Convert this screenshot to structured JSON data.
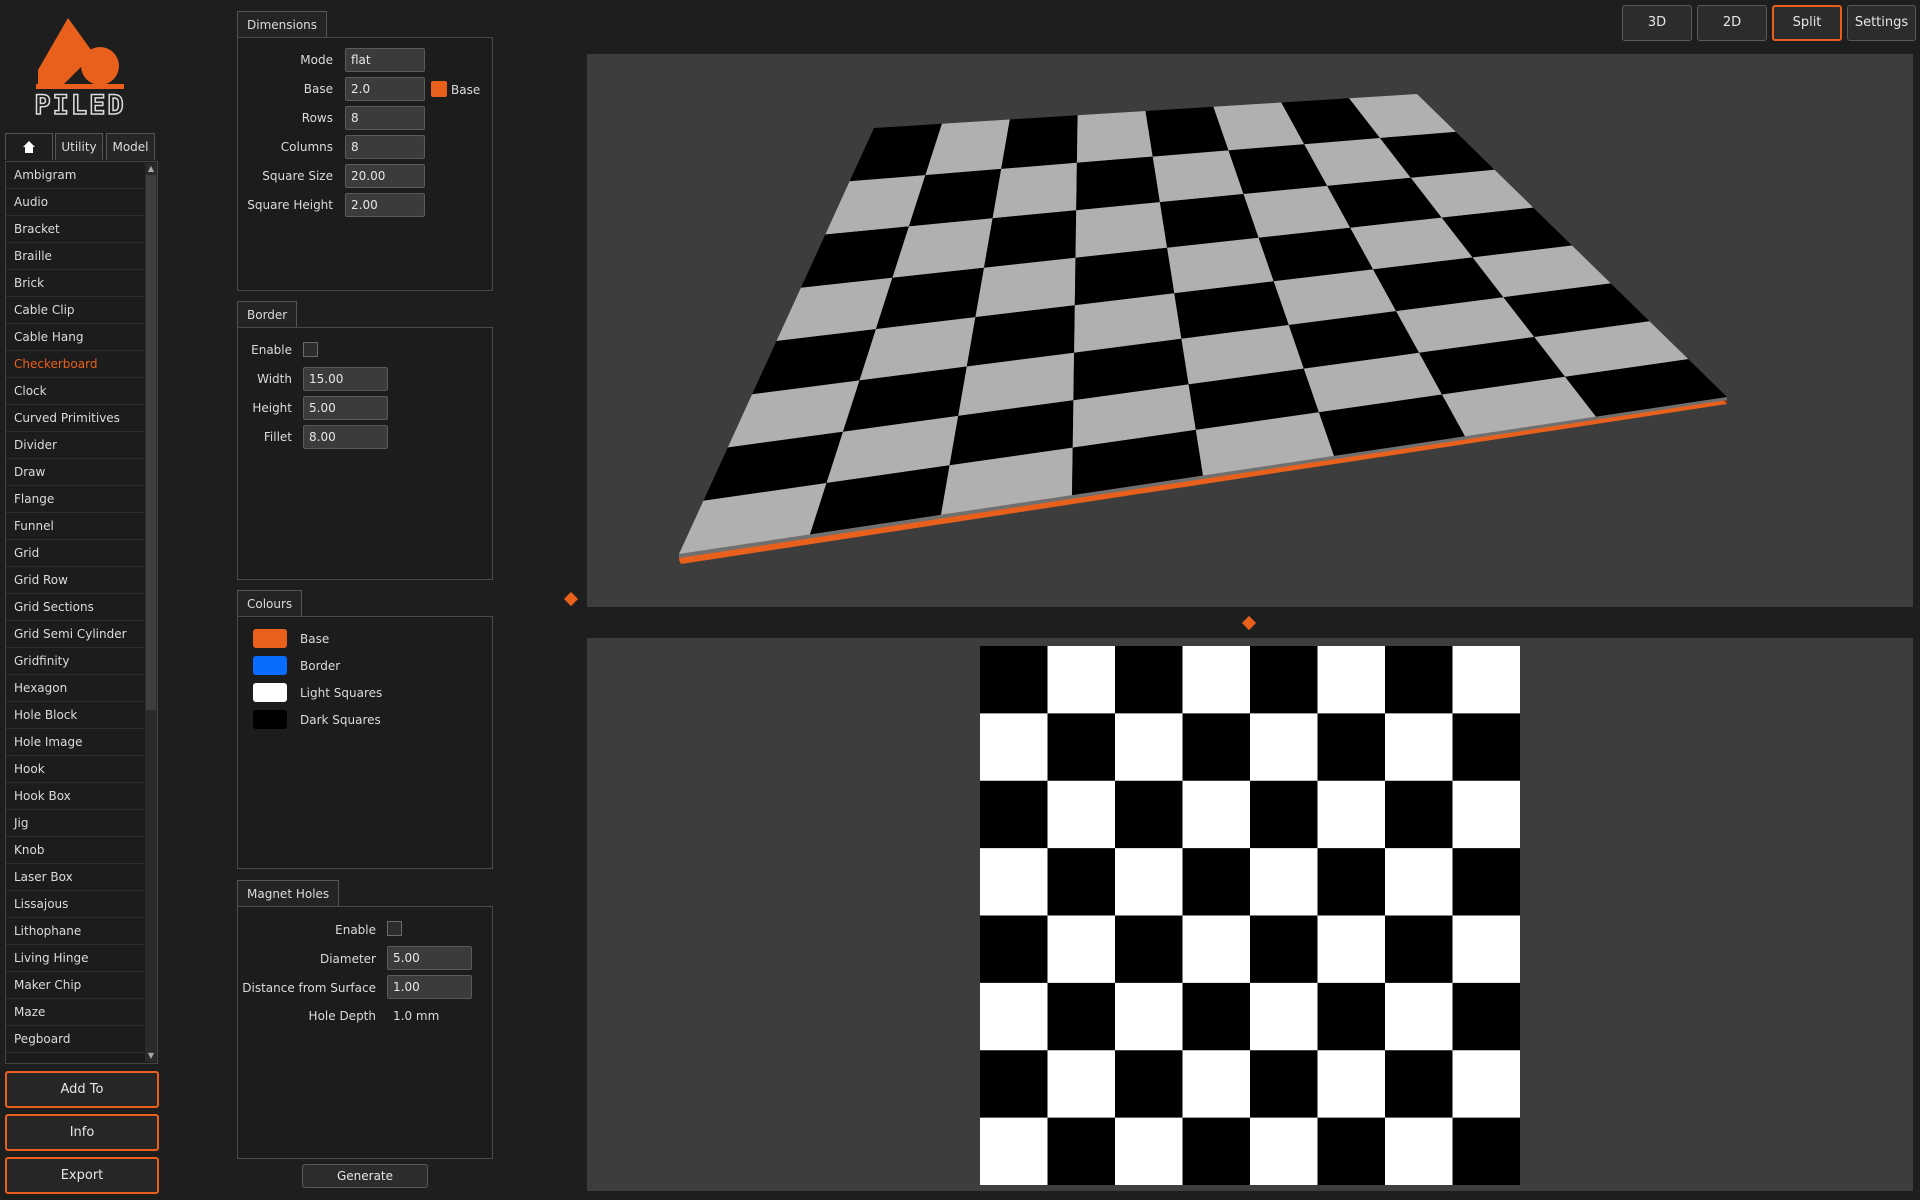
{
  "logo": {
    "text": "PILED"
  },
  "sidebar": {
    "tabs": [
      {
        "label": "",
        "icon": "home-icon"
      },
      {
        "label": "Utility"
      },
      {
        "label": "Model"
      }
    ],
    "items": [
      "Ambigram",
      "Audio",
      "Bracket",
      "Braille",
      "Brick",
      "Cable Clip",
      "Cable Hang",
      "Checkerboard",
      "Clock",
      "Curved Primitives",
      "Divider",
      "Draw",
      "Flange",
      "Funnel",
      "Grid",
      "Grid Row",
      "Grid Sections",
      "Grid Semi Cylinder",
      "Gridfinity",
      "Hexagon",
      "Hole Block",
      "Hole Image",
      "Hook",
      "Hook Box",
      "Jig",
      "Knob",
      "Laser Box",
      "Lissajous",
      "Lithophane",
      "Living Hinge",
      "Maker Chip",
      "Maze",
      "Pegboard"
    ],
    "selected": "Checkerboard",
    "buttons": {
      "add": "Add To",
      "info": "Info",
      "export": "Export"
    }
  },
  "dimensions": {
    "title": "Dimensions",
    "mode_label": "Mode",
    "mode_value": "flat",
    "base_label": "Base",
    "base_value": "2.0",
    "base_swatch_label": "Base",
    "rows_label": "Rows",
    "rows_value": "8",
    "columns_label": "Columns",
    "columns_value": "8",
    "square_size_label": "Square Size",
    "square_size_value": "20.00",
    "square_height_label": "Square Height",
    "square_height_value": "2.00"
  },
  "border": {
    "title": "Border",
    "enable_label": "Enable",
    "width_label": "Width",
    "width_value": "15.00",
    "height_label": "Height",
    "height_value": "5.00",
    "fillet_label": "Fillet",
    "fillet_value": "8.00"
  },
  "colours": {
    "title": "Colours",
    "items": [
      {
        "label": "Base",
        "color": "#e8601c"
      },
      {
        "label": "Border",
        "color": "#0a6cff"
      },
      {
        "label": "Light Squares",
        "color": "#ffffff"
      },
      {
        "label": "Dark Squares",
        "color": "#000000"
      }
    ]
  },
  "magnet": {
    "title": "Magnet Holes",
    "enable_label": "Enable",
    "diameter_label": "Diameter",
    "diameter_value": "5.00",
    "distance_label": "Distance from Surface",
    "distance_value": "1.00",
    "depth_label": "Hole Depth",
    "depth_value": "1.0 mm"
  },
  "generate_label": "Generate",
  "view_buttons": {
    "b3d": "3D",
    "b2d": "2D",
    "split": "Split",
    "settings": "Settings"
  },
  "active_view": "Split",
  "board": {
    "rows": 8,
    "columns": 8,
    "light": "#ffffff",
    "dark": "#000000",
    "light_3d": "#b0b0b0",
    "base": "#e8601c"
  },
  "accent": "#e8601c"
}
